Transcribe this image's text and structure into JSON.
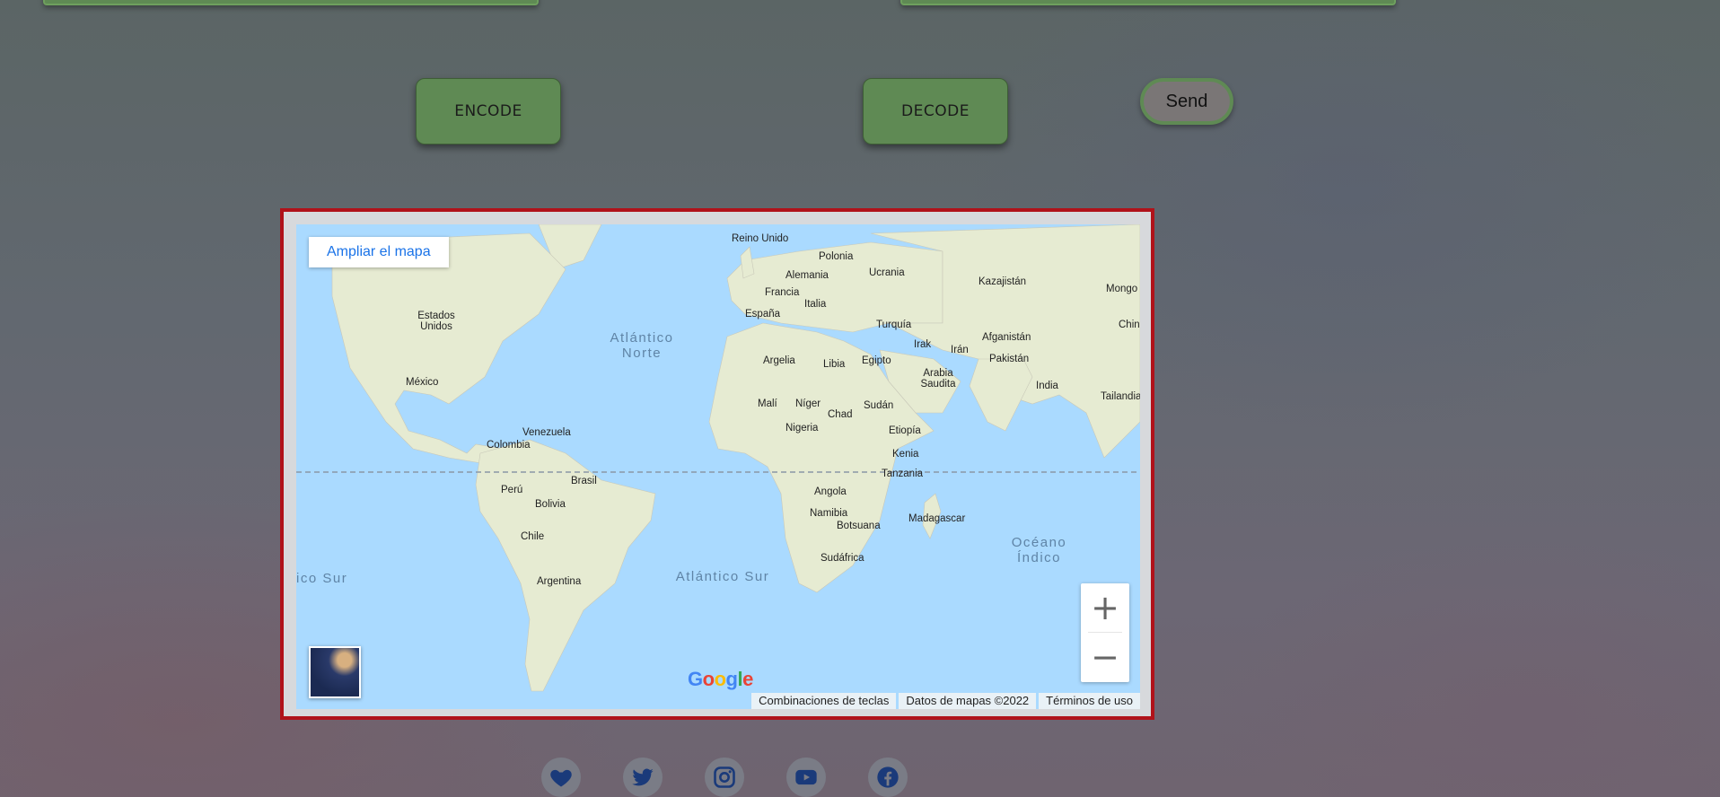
{
  "buttons": {
    "encode": "ENCODE",
    "decode": "DECODE",
    "send": "Send"
  },
  "map": {
    "enlarge_label": "Ampliar el mapa",
    "zoom_in": "+",
    "zoom_out": "−",
    "logo": [
      "G",
      "o",
      "o",
      "g",
      "l",
      "e"
    ],
    "attribution": {
      "shortcuts": "Combinaciones de teclas",
      "data": "Datos de mapas ©2022",
      "terms": "Términos de uso"
    },
    "oceans": {
      "atlantic_north": "Atlántico Norte",
      "atlantic_south": "Atlántico Sur",
      "indian": "Océano Índico",
      "pacific_south": "ico Sur"
    },
    "countries": {
      "reino_unido": "Reino Unido",
      "polonia": "Polonia",
      "alemania": "Alemania",
      "ucrania": "Ucrania",
      "kazajistan": "Kazajistán",
      "mongolia": "Mongo",
      "francia": "Francia",
      "italia": "Italia",
      "espana": "España",
      "turquia": "Turquía",
      "china": "China",
      "estados_unidos": "Estados Unidos",
      "irak": "Irak",
      "iran": "Irán",
      "afganistan": "Afganistán",
      "argelia": "Argelia",
      "libia": "Libia",
      "egipto": "Egipto",
      "pakistan": "Pakistán",
      "mexico": "México",
      "arabia_saudita": "Arabia Saudita",
      "india": "India",
      "mali": "Malí",
      "niger": "Níger",
      "sudan": "Sudán",
      "tailandia": "Tailandia",
      "chad": "Chad",
      "venezuela": "Venezuela",
      "nigeria": "Nigeria",
      "etiopia": "Etiopía",
      "colombia": "Colombia",
      "kenia": "Kenia",
      "brasil": "Brasil",
      "tanzania": "Tanzania",
      "peru": "Perú",
      "angola": "Angola",
      "bolivia": "Bolivia",
      "namibia": "Namibia",
      "madagascar": "Madagascar",
      "botsuana": "Botsuana",
      "chile": "Chile",
      "sudafrica": "Sudáfrica",
      "argentina": "Argentina"
    }
  },
  "social": [
    "heart-icon",
    "twitter-icon",
    "instagram-icon",
    "youtube-icon",
    "facebook-icon"
  ],
  "colors": {
    "button_green": "#5f8a54",
    "map_border": "#b0121a",
    "water": "#aadaff",
    "icon": "#1a3a7a"
  }
}
